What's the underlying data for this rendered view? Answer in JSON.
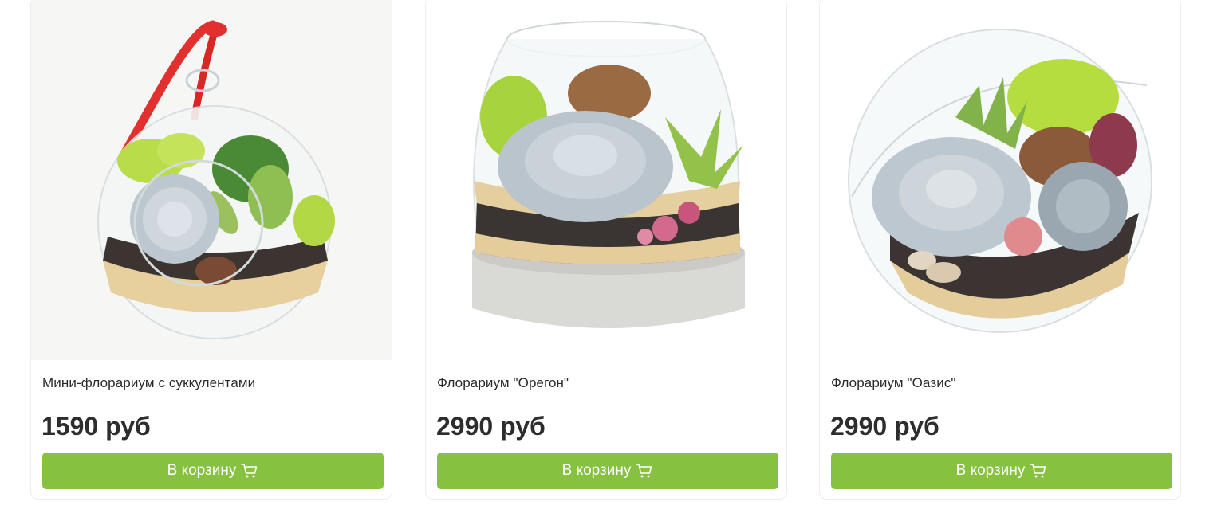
{
  "products": [
    {
      "title": "Мини-флорариум с суккулентами",
      "price": "1590 руб",
      "button_label": "В корзину",
      "button_icon": "cart-icon"
    },
    {
      "title": "Флорариум \"Орегон\"",
      "price": "2990 руб",
      "button_label": "В корзину",
      "button_icon": "cart-icon"
    },
    {
      "title": "Флорариум \"Оазис\"",
      "price": "2990 руб",
      "button_label": "В корзину",
      "button_icon": "cart-icon"
    }
  ],
  "colors": {
    "button_bg": "#86c240",
    "button_text": "#ffffff",
    "price_text": "#2d2d2d",
    "card_border": "#ececec"
  }
}
